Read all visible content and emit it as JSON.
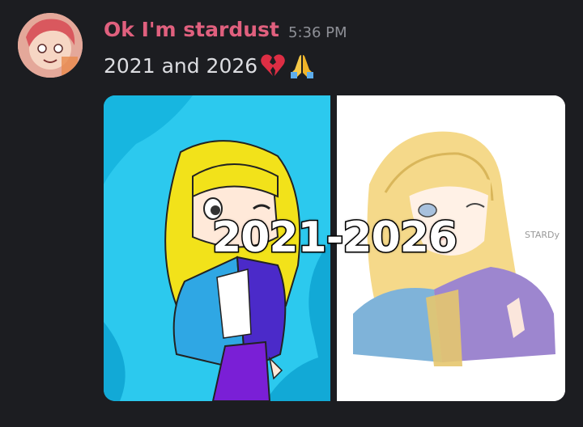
{
  "message": {
    "username": "Ok I'm stardust",
    "timestamp": "5:36 PM",
    "text": "2021 and 2026",
    "emojis": [
      "broken-heart-icon",
      "folded-hands-icon"
    ],
    "avatar": "avatar-image"
  },
  "attachment": {
    "overlay_text": "2021-2026",
    "left_image": "2021-drawing",
    "right_image": "2026-drawing",
    "signature": "STARDy"
  },
  "colors": {
    "background": "#1c1d21",
    "username": "#e0607e",
    "timestamp": "#8e9097",
    "text": "#dcdde1"
  }
}
